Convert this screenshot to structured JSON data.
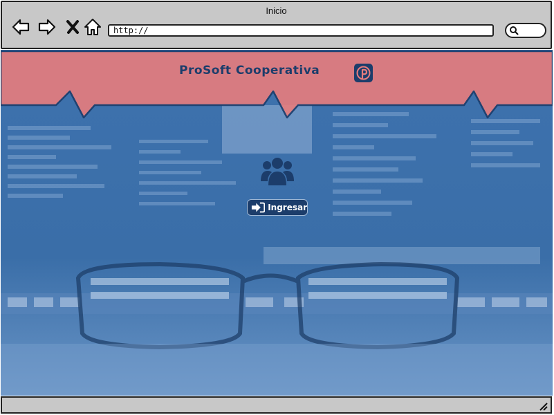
{
  "window": {
    "title": "Inicio"
  },
  "toolbar": {
    "url": "http://",
    "icons": [
      "back-icon",
      "forward-icon",
      "close-icon",
      "home-icon",
      "search-icon"
    ]
  },
  "header": {
    "site_title": "ProSoft Cooperativa",
    "social_icon": "pinterest-icon",
    "band_color": "#e87d7d"
  },
  "main": {
    "users_icon": "users-group-icon",
    "login_label": "Ingresar",
    "login_icon": "sign-in-icon",
    "accent": "#1c3d6b"
  }
}
